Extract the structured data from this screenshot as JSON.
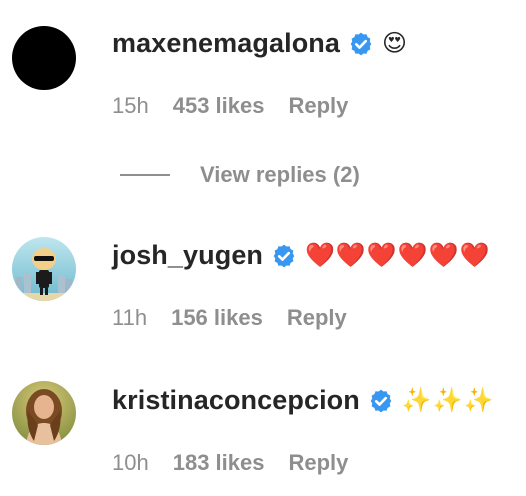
{
  "comments": [
    {
      "avatar_icon": "black-circle-avatar",
      "username": "maxenemagalona",
      "verified": true,
      "text": "😍",
      "time": "15h",
      "likes": "453 likes",
      "reply": "Reply"
    },
    {
      "avatar_icon": "cartoon-figure-avatar",
      "username": "josh_yugen",
      "verified": true,
      "text": "❤️❤️❤️❤️❤️❤️",
      "time": "11h",
      "likes": "156 likes",
      "reply": "Reply"
    },
    {
      "avatar_icon": "portrait-photo-avatar",
      "username": "kristinaconcepcion",
      "verified": true,
      "text": "✨✨✨",
      "time": "10h",
      "likes": "183 likes",
      "reply": "Reply"
    }
  ],
  "view_replies": "View replies (2)",
  "colors": {
    "text_primary": "#262626",
    "text_secondary": "#8e8e8e",
    "verified_blue": "#3897f0"
  }
}
